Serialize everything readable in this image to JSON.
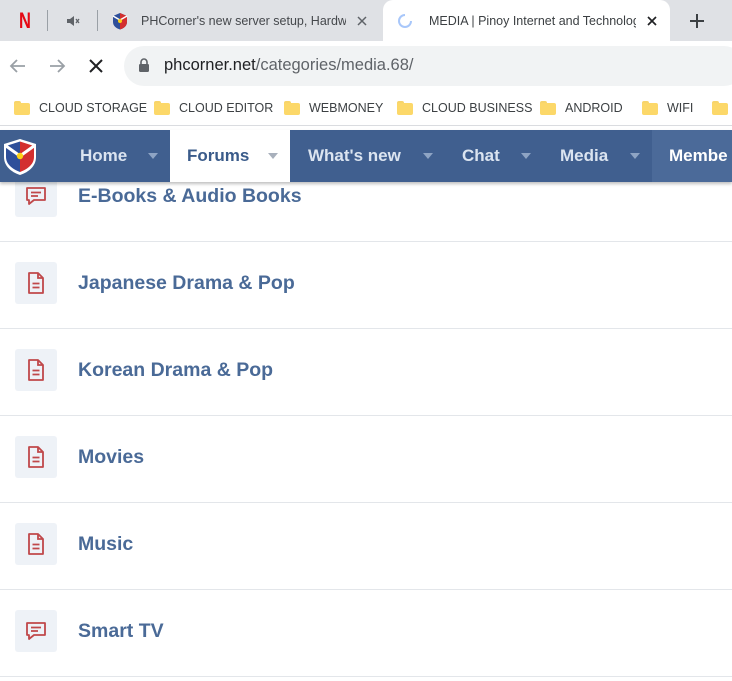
{
  "browser": {
    "pinned_tabs": [
      {
        "icon": "netflix-logo-icon",
        "letter": "N",
        "color": "#e50914"
      },
      {
        "icon": "speaker-muted-icon"
      }
    ],
    "tabs": [
      {
        "title": "PHCorner's new server setup, Hardware",
        "icon": "phcorner-favicon-icon",
        "active": false
      },
      {
        "title": "MEDIA | Pinoy Internet and Technology",
        "icon": "loading-spinner-icon",
        "active": true
      }
    ],
    "url": {
      "host": "phcorner.net",
      "path": "/categories/media.68/"
    },
    "bookmarks": [
      {
        "label": "CLOUD STORAGE",
        "icon": "folder-icon"
      },
      {
        "label": "CLOUD EDITOR",
        "icon": "folder-icon"
      },
      {
        "label": "WEBMONEY",
        "icon": "folder-icon"
      },
      {
        "label": "CLOUD BUSINESS",
        "icon": "folder-icon"
      },
      {
        "label": "ANDROID",
        "icon": "folder-icon"
      },
      {
        "label": "WIFI",
        "icon": "folder-icon"
      }
    ]
  },
  "site_nav": {
    "items": [
      {
        "label": "Home",
        "has_caret": true
      },
      {
        "label": "Forums",
        "has_caret": true,
        "current": true
      },
      {
        "label": "What's new",
        "has_caret": true
      },
      {
        "label": "Chat",
        "has_caret": true
      },
      {
        "label": "Media",
        "has_caret": true
      },
      {
        "label": "Membe",
        "has_caret": false
      }
    ],
    "colors": {
      "bar": "#405f8f",
      "active_bg": "#ffffff",
      "active_text": "#3a5b8a"
    }
  },
  "forums": [
    {
      "name": "E-Books & Audio Books",
      "icon": "chat-bubble-icon"
    },
    {
      "name": "Japanese Drama & Pop",
      "icon": "document-icon"
    },
    {
      "name": "Korean Drama & Pop",
      "icon": "document-icon"
    },
    {
      "name": "Movies",
      "icon": "document-icon"
    },
    {
      "name": "Music",
      "icon": "document-icon"
    },
    {
      "name": "Smart TV",
      "icon": "chat-bubble-icon"
    }
  ],
  "colors": {
    "forum_title": "#4a6a97",
    "forum_icon": "#c0484a",
    "icon_tile": "#eef2f7"
  }
}
